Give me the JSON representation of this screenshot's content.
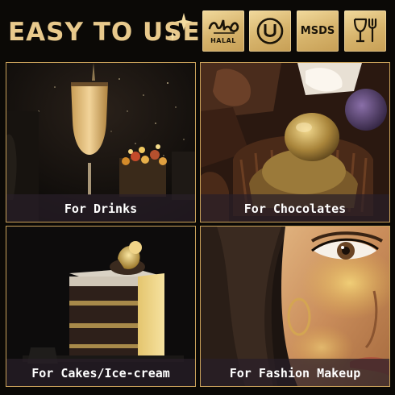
{
  "header": {
    "title": "EASY TO USE",
    "badges": [
      {
        "icon": "halal-icon",
        "label": "HALAL"
      },
      {
        "icon": "kosher-u-icon",
        "label": ""
      },
      {
        "icon": "msds-icon",
        "label": "MSDS"
      },
      {
        "icon": "food-safe-icon",
        "label": ""
      }
    ]
  },
  "panels": [
    {
      "caption": "For Drinks"
    },
    {
      "caption": "For Chocolates"
    },
    {
      "caption": "For Cakes/Ice-cream"
    },
    {
      "caption": "For Fashion Makeup"
    }
  ],
  "colors": {
    "gold": "#e8c98c",
    "border": "#c9a15a",
    "background": "#0b0906"
  }
}
